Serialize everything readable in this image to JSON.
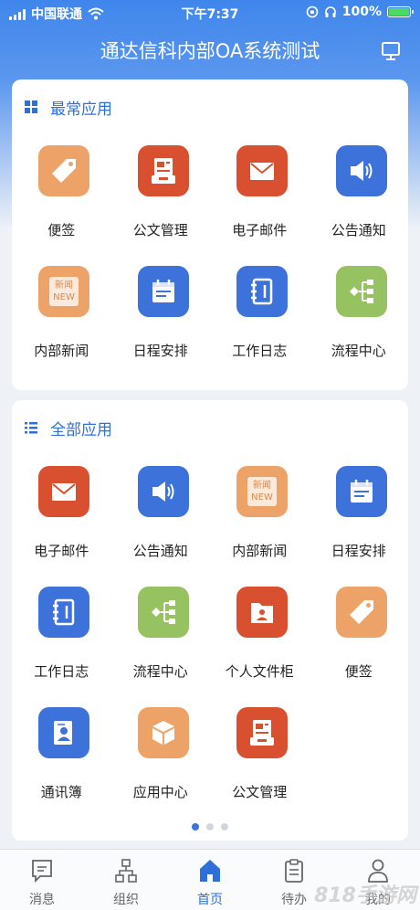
{
  "status": {
    "carrier": "中国联通",
    "time": "下午7:37",
    "battery": "100%"
  },
  "header": {
    "title": "通达信科内部OA系统测试"
  },
  "frequent": {
    "title": "最常应用",
    "apps": [
      {
        "label": "便签",
        "icon": "tag-icon",
        "color": "#eda368"
      },
      {
        "label": "公文管理",
        "icon": "document-icon",
        "color": "#d8502f"
      },
      {
        "label": "电子邮件",
        "icon": "mail-icon",
        "color": "#d8502f"
      },
      {
        "label": "公告通知",
        "icon": "speaker-icon",
        "color": "#3d72da"
      },
      {
        "label": "内部新闻",
        "icon": "news-icon",
        "color": "#eda368"
      },
      {
        "label": "日程安排",
        "icon": "calendar-icon",
        "color": "#3d72da"
      },
      {
        "label": "工作日志",
        "icon": "notebook-icon",
        "color": "#3d72da"
      },
      {
        "label": "流程中心",
        "icon": "flow-icon",
        "color": "#97c261"
      }
    ]
  },
  "all": {
    "title": "全部应用",
    "apps": [
      {
        "label": "电子邮件",
        "icon": "mail-icon"
      },
      {
        "label": "公告通知",
        "icon": "speaker-icon"
      },
      {
        "label": "内部新闻",
        "icon": "news-icon"
      },
      {
        "label": "日程安排",
        "icon": "calendar-icon"
      },
      {
        "label": "工作日志",
        "icon": "notebook-icon"
      },
      {
        "label": "流程中心",
        "icon": "flow-icon"
      },
      {
        "label": "个人文件柜",
        "icon": "folder-user-icon"
      },
      {
        "label": "便签",
        "icon": "tag-icon"
      },
      {
        "label": "通讯簿",
        "icon": "contact-icon"
      },
      {
        "label": "应用中心",
        "icon": "cube-icon"
      },
      {
        "label": "公文管理",
        "icon": "document-icon"
      }
    ]
  },
  "news_icon_text": [
    "新闻",
    "NEW"
  ],
  "tabs": [
    {
      "label": "消息",
      "icon": "message-icon"
    },
    {
      "label": "组织",
      "icon": "org-icon"
    },
    {
      "label": "首页",
      "icon": "home-icon",
      "active": true
    },
    {
      "label": "待办",
      "icon": "clipboard-icon"
    },
    {
      "label": "我的",
      "icon": "user-icon"
    }
  ],
  "watermark": "818手游网",
  "colors": {
    "accent": "#2f6fd8",
    "orange": "#eda368",
    "red": "#d8502f",
    "blue": "#3d72da",
    "green": "#97c261"
  }
}
